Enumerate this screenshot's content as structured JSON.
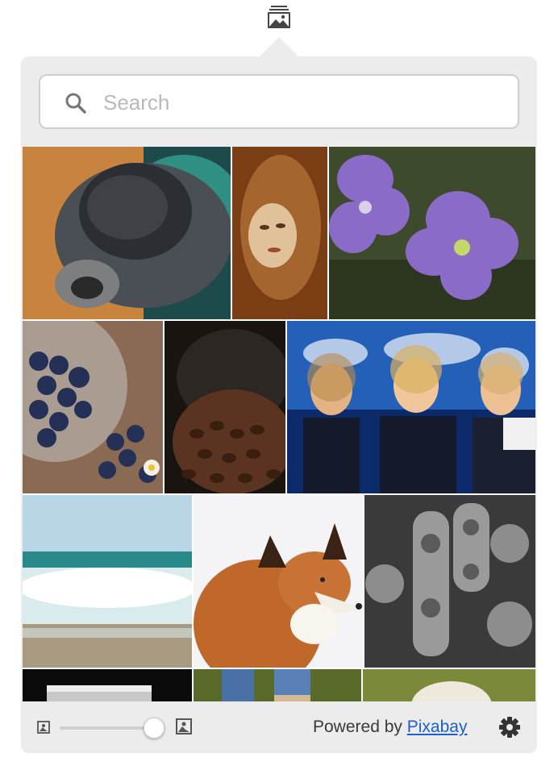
{
  "search": {
    "placeholder": "Search",
    "value": ""
  },
  "footer": {
    "powered_prefix": "Powered by",
    "link_text": "Pixabay",
    "size_level": 0.9
  },
  "colors": {
    "popover_bg": "#ececec",
    "link": "#1a5fd6"
  },
  "icons": {
    "menubar": "image-stack-icon",
    "search": "search-icon",
    "small_size": "small-image-icon",
    "large_size": "large-image-icon",
    "settings": "gear-icon"
  },
  "images": [
    {
      "subject": "fly"
    },
    {
      "subject": "woman-portrait"
    },
    {
      "subject": "purple-flowers"
    },
    {
      "subject": "blueberries"
    },
    {
      "subject": "coffee-beans"
    },
    {
      "subject": "call-center"
    },
    {
      "subject": "sea-waves"
    },
    {
      "subject": "fox"
    },
    {
      "subject": "chain"
    },
    {
      "subject": "glass"
    },
    {
      "subject": "jeans"
    },
    {
      "subject": "dog"
    }
  ]
}
